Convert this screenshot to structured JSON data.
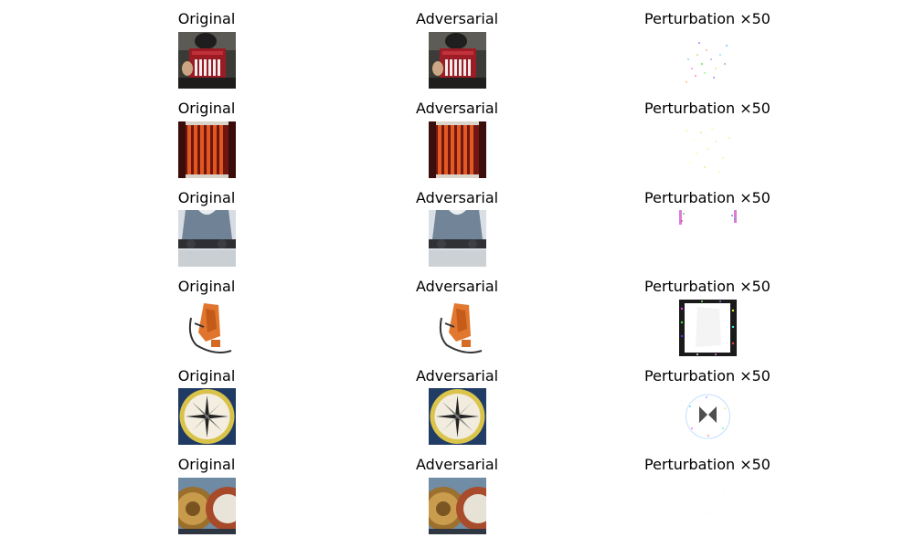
{
  "rows": [
    {
      "original_title": "Original",
      "adversarial_title": "Adversarial",
      "perturbation_title": "Perturbation ×50",
      "subject": "accordion-player"
    },
    {
      "original_title": "Original",
      "adversarial_title": "Adversarial",
      "perturbation_title": "Perturbation ×50",
      "subject": "red-accordion-bellows"
    },
    {
      "original_title": "Original",
      "adversarial_title": "Adversarial",
      "perturbation_title": "Perturbation ×50",
      "subject": "person-with-handlebar"
    },
    {
      "original_title": "Original",
      "adversarial_title": "Adversarial",
      "perturbation_title": "Perturbation ×50",
      "subject": "orange-backpack-frame"
    },
    {
      "original_title": "Original",
      "adversarial_title": "Adversarial",
      "perturbation_title": "Perturbation ×50",
      "subject": "gold-compass"
    },
    {
      "original_title": "Original",
      "adversarial_title": "Adversarial",
      "perturbation_title": "Perturbation ×50",
      "subject": "barometer-dials"
    }
  ]
}
